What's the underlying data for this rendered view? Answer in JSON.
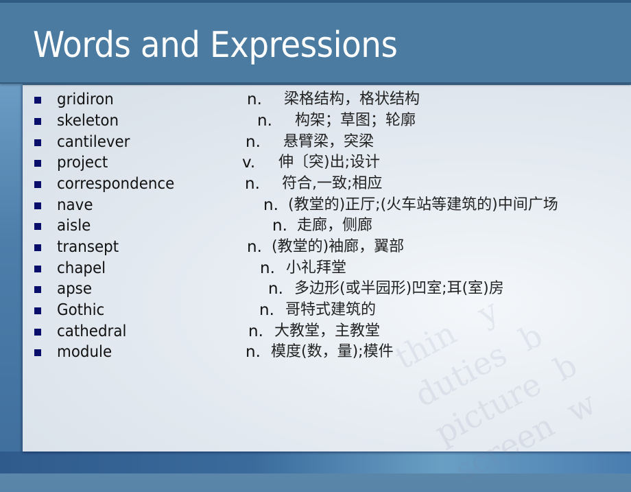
{
  "slide": {
    "title": "Words and Expressions",
    "colors": {
      "header_bg": "#4c7ba1",
      "bullet": "#0a0e6b",
      "title_text": "#ffffff"
    },
    "bullet_icon": "square-bullet",
    "entries": [
      {
        "term": "gridiron",
        "pos": "n.",
        "definition": "梁格结构，格状结构"
      },
      {
        "term": "skeleton",
        "pos": "n.",
        "definition": "构架；草图；轮廓"
      },
      {
        "term": "cantilever",
        "pos": "n.",
        "definition": "悬臂梁，突梁"
      },
      {
        "term": "project",
        "pos": "v.",
        "definition": "伸〔突)出;设计"
      },
      {
        "term": "correspondence",
        "pos": "n.",
        "definition": "符合,一致;相应"
      },
      {
        "term": "nave",
        "pos": "n.",
        "definition": "(教堂的)正厅;(火车站等建筑的)中间广场"
      },
      {
        "term": "aisle",
        "pos": "n.",
        "definition": "走廊，侧廊"
      },
      {
        "term": "transept",
        "pos": "n.",
        "definition": "(教堂的)袖廊，翼部"
      },
      {
        "term": "chapel",
        "pos": "n.",
        "definition": "小礼拜堂"
      },
      {
        "term": "apse",
        "pos": "n.",
        "definition": "多边形(或半园形)凹室;耳(室)房"
      },
      {
        "term": "Gothic",
        "pos": "n.",
        "definition": "哥特式建筑的"
      },
      {
        "term": "cathedral",
        "pos": "n.",
        "definition": "大教堂，主教堂"
      },
      {
        "term": "module",
        "pos": "n.",
        "definition": "模度(数，量);模件"
      }
    ]
  }
}
